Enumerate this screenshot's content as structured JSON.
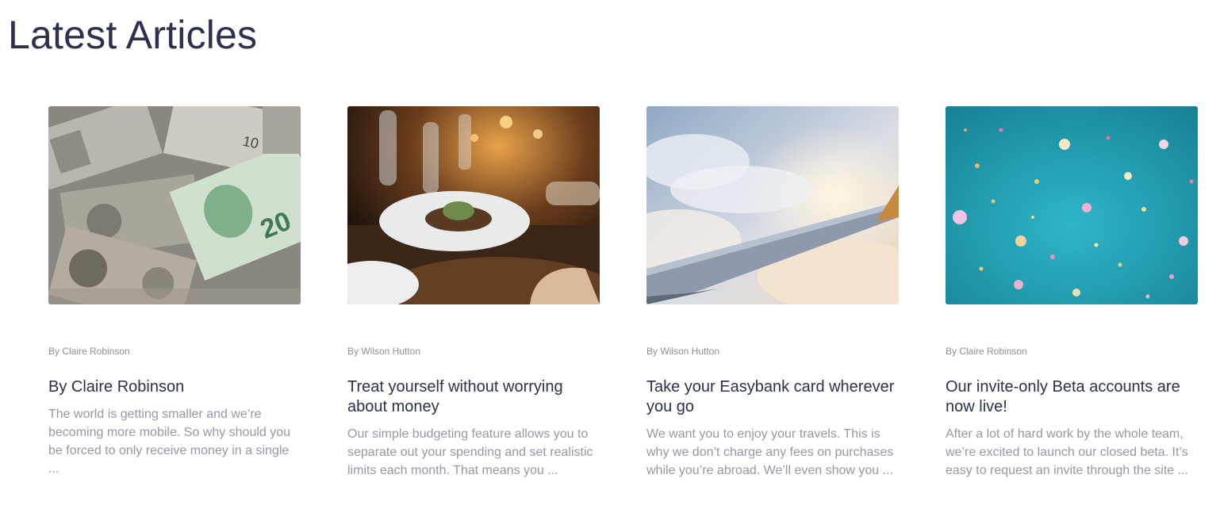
{
  "section": {
    "title": "Latest Articles"
  },
  "articles": [
    {
      "image": "cash-money-photo",
      "author": "By Claire Robinson",
      "title": "By Claire Robinson",
      "excerpt": "The world is getting smaller and we’re becoming more mobile. So why should you be forced to only receive money in a single ..."
    },
    {
      "image": "restaurant-dinner-photo",
      "author": "By Wilson Hutton",
      "title": "Treat yourself without worrying about money",
      "excerpt": "Our simple budgeting feature allows you to separate out your spending and set realistic limits each month. That means you ..."
    },
    {
      "image": "airplane-wing-photo",
      "author": "By Wilson Hutton",
      "title": "Take your Easybank card wherever you go",
      "excerpt": "We want you to enjoy your travels. This is why we don’t charge any fees on purchases while you’re abroad. We’ll even show you ..."
    },
    {
      "image": "confetti-photo",
      "author": "By Claire Robinson",
      "title": "Our invite-only Beta accounts are now live!",
      "excerpt": "After a lot of hard work by the whole team, we’re excited to launch our closed beta. It’s easy to request an invite through the site ..."
    }
  ]
}
